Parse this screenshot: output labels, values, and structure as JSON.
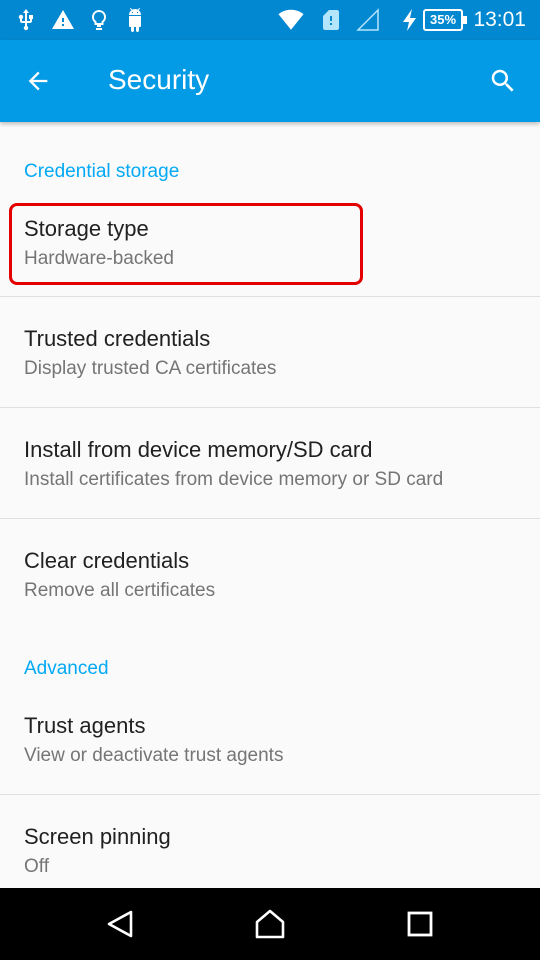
{
  "status_bar": {
    "time": "13:01",
    "battery": "35%",
    "icons": [
      "usb-icon",
      "warning-icon",
      "lightbulb-icon",
      "android-icon",
      "wifi-icon",
      "sim-alert-icon",
      "signal-icon",
      "charging-icon"
    ]
  },
  "app_bar": {
    "title": "Security",
    "back_icon": "arrow-left-icon",
    "search_icon": "search-icon"
  },
  "sections": {
    "credential_storage": "Credential storage",
    "advanced": "Advanced"
  },
  "items": [
    {
      "title": "Storage type",
      "summary": "Hardware-backed"
    },
    {
      "title": "Trusted credentials",
      "summary": "Display trusted CA certificates"
    },
    {
      "title": "Install from device memory/SD card",
      "summary": "Install certificates from device memory or SD card"
    },
    {
      "title": "Clear credentials",
      "summary": "Remove all certificates"
    },
    {
      "title": "Trust agents",
      "summary": "View or deactivate trust agents"
    },
    {
      "title": "Screen pinning",
      "summary": "Off"
    }
  ],
  "nav_bar": {
    "icons": [
      "back-triangle-icon",
      "home-icon",
      "recents-icon"
    ]
  },
  "colors": {
    "status_bar": "#0288d1",
    "app_bar": "#039be5",
    "accent": "#03a9f4",
    "highlight": "#e50000"
  }
}
